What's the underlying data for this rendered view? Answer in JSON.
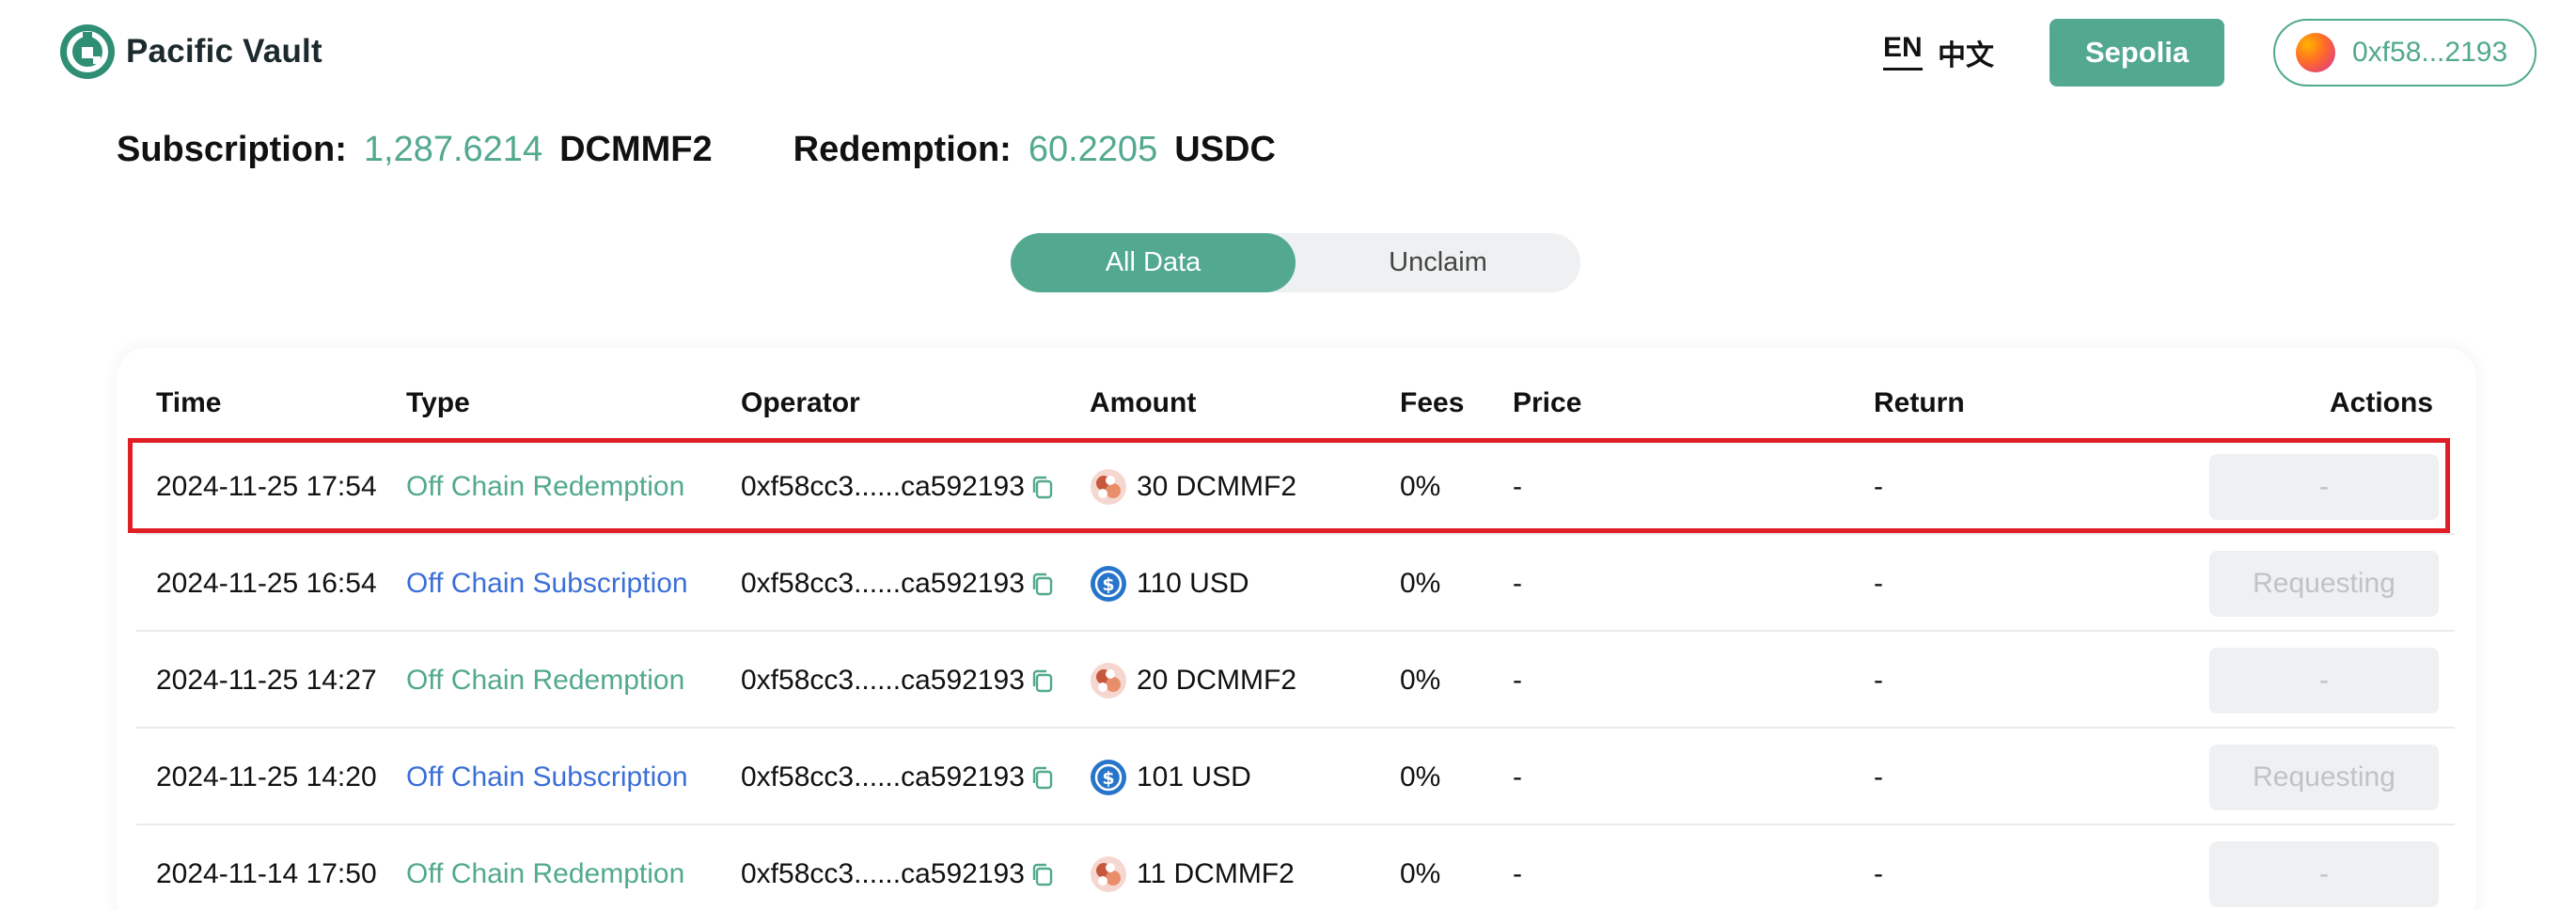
{
  "header": {
    "logo_text": "Pacific Vault",
    "lang_en": "EN",
    "lang_zh": "中文",
    "network_button": "Sepolia",
    "wallet_address": "0xf58...2193"
  },
  "summary": {
    "subscription_label": "Subscription:",
    "subscription_value": "1,287.6214",
    "subscription_unit": "DCMMF2",
    "redemption_label": "Redemption:",
    "redemption_value": "60.2205",
    "redemption_unit": "USDC"
  },
  "tabs": [
    {
      "label": "All Data",
      "active": true
    },
    {
      "label": "Unclaim",
      "active": false
    }
  ],
  "table": {
    "columns": [
      "Time",
      "Type",
      "Operator",
      "Amount",
      "Fees",
      "Price",
      "Return",
      "Actions"
    ],
    "rows": [
      {
        "time": "2024-11-25 17:54",
        "type": "Off Chain Redemption",
        "kind": "redeem",
        "operator": "0xf58cc3......ca592193",
        "amount": "30",
        "token": "DCMMF2",
        "token_icon": "dcmmf2-token-icon",
        "fees": "0%",
        "price": "-",
        "return": "-",
        "action": "-"
      },
      {
        "time": "2024-11-25 16:54",
        "type": "Off Chain Subscription",
        "kind": "sub",
        "operator": "0xf58cc3......ca592193",
        "amount": "110",
        "token": "USD",
        "token_icon": "usd-token-icon",
        "fees": "0%",
        "price": "-",
        "return": "-",
        "action": "Requesting"
      },
      {
        "time": "2024-11-25 14:27",
        "type": "Off Chain Redemption",
        "kind": "redeem",
        "operator": "0xf58cc3......ca592193",
        "amount": "20",
        "token": "DCMMF2",
        "token_icon": "dcmmf2-token-icon",
        "fees": "0%",
        "price": "-",
        "return": "-",
        "action": "-"
      },
      {
        "time": "2024-11-25 14:20",
        "type": "Off Chain Subscription",
        "kind": "sub",
        "operator": "0xf58cc3......ca592193",
        "amount": "101",
        "token": "USD",
        "token_icon": "usd-token-icon",
        "fees": "0%",
        "price": "-",
        "return": "-",
        "action": "Requesting"
      },
      {
        "time": "2024-11-14 17:50",
        "type": "Off Chain Redemption",
        "kind": "redeem",
        "operator": "0xf58cc3......ca592193",
        "amount": "11",
        "token": "DCMMF2",
        "token_icon": "dcmmf2-token-icon",
        "fees": "0%",
        "price": "-",
        "return": "-",
        "action": "-"
      }
    ]
  },
  "colors": {
    "accent": "#52a98f",
    "subscription_link": "#3b6fd8",
    "highlight": "#e01e26"
  }
}
